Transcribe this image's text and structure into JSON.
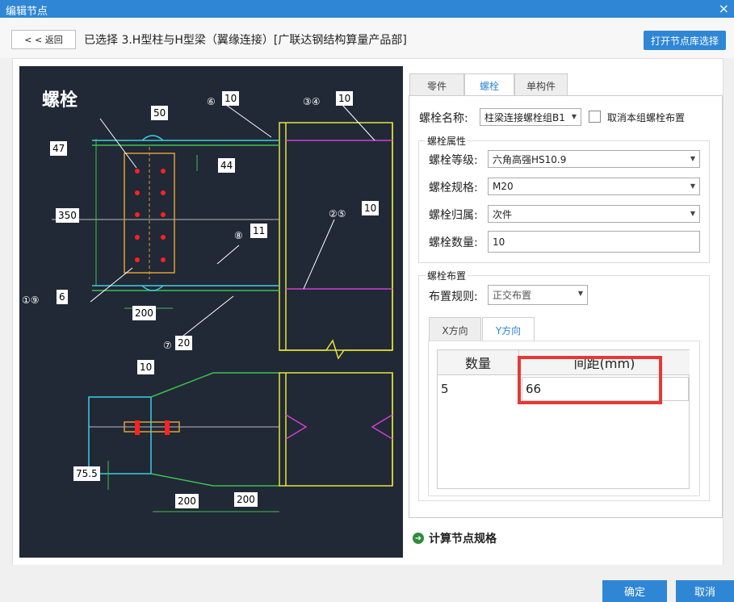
{
  "window": {
    "title": "编辑节点",
    "close_glyph": "×"
  },
  "topbar": {
    "back_label": "< < 返回",
    "selected_text": "已选择  3.H型柱与H型梁（翼缘连接）[广联达钢结构算量产品部]",
    "open_library_label": "打开节点库选择"
  },
  "drawing": {
    "big_label": "螺栓",
    "dims": [
      "50",
      "47",
      "44",
      "350",
      "6",
      "200",
      "20",
      "10",
      "75.5",
      "200",
      "200"
    ],
    "circle_labels": [
      {
        "text": "⑥",
        "value": "10"
      },
      {
        "text": "③④",
        "value": "10"
      },
      {
        "text": "②⑤",
        "value": "10"
      },
      {
        "text": "⑧",
        "value": "11"
      },
      {
        "text": "①⑨",
        "value": "6"
      },
      {
        "text": "⑦",
        "value": "20"
      }
    ]
  },
  "tabs": [
    "零件",
    "螺栓",
    "单构件"
  ],
  "active_tab": "螺栓",
  "bolt": {
    "name_label": "螺栓名称:",
    "name_value": "柱梁连接螺栓组B1",
    "cancel_label": "取消本组螺栓布置",
    "props_title": "螺栓属性",
    "grade_label": "螺栓等级:",
    "grade_value": "六角高强HS10.9",
    "spec_label": "螺栓规格:",
    "spec_value": "M20",
    "owner_label": "螺栓归属:",
    "owner_value": "次件",
    "count_label": "螺栓数量:",
    "count_value": "10",
    "layout_title": "螺栓布置",
    "rule_label": "布置规则:",
    "rule_value": "正交布置",
    "sub_tabs": [
      "X方向",
      "Y方向"
    ],
    "active_sub_tab": "Y方向",
    "table": {
      "headers": [
        "数量",
        "间距(mm)"
      ],
      "rows": [
        [
          "5",
          "66"
        ]
      ]
    }
  },
  "calc_label": "计算节点规格",
  "buttons": {
    "ok": "确定",
    "cancel": "取消"
  },
  "colors": {
    "accent": "#2e86d5",
    "highlight": "#e53935",
    "drawing_bg": "#212836"
  }
}
